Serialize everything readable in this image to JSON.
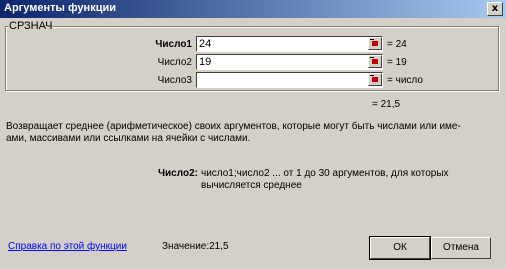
{
  "window": {
    "title": "Аргументы функции",
    "close_label": "x"
  },
  "function": {
    "name": "СРЗНАЧ"
  },
  "args": [
    {
      "label": "Число1",
      "value": "24",
      "result": "= 24"
    },
    {
      "label": "Число2",
      "value": "19",
      "result": "= 19"
    },
    {
      "label": "Число3",
      "value": "",
      "result": "= число"
    }
  ],
  "total_result": "= 21,5",
  "description": "Возвращает среднее (арифметическое) своих аргументов, которые могут быть числами или име-ами, массивами или ссылками на ячейки с числами.",
  "current_arg": {
    "name": "Число2:",
    "description": "число1;число2 ... от 1 до 30 аргументов, для которых вычисляется среднее"
  },
  "footer": {
    "help_link": "Справка по этой функции",
    "value_label": "Значение:21,5",
    "ok_label": "ОК",
    "cancel_label": "Отмена"
  }
}
